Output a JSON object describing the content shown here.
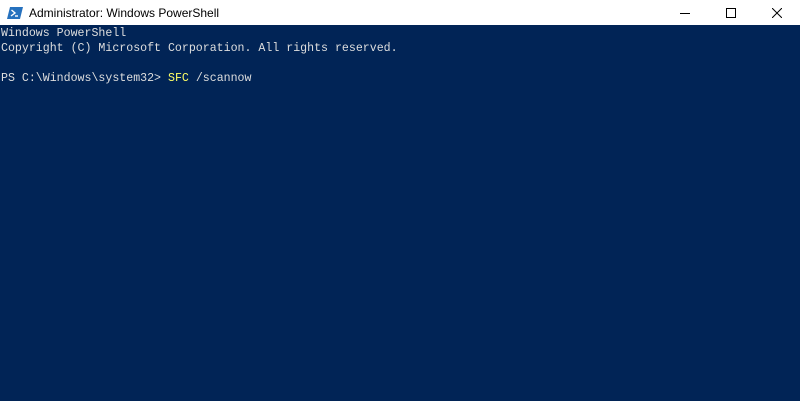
{
  "window": {
    "title": "Administrator: Windows PowerShell",
    "icon": "powershell-icon"
  },
  "controls": {
    "minimize_icon": "minimize-icon",
    "maximize_icon": "maximize-icon",
    "close_icon": "close-icon"
  },
  "console": {
    "banner_line1": "Windows PowerShell",
    "banner_line2": "Copyright (C) Microsoft Corporation. All rights reserved.",
    "prompt": "PS C:\\Windows\\system32> ",
    "command": "SFC",
    "argument": " /scannow"
  },
  "colors": {
    "background": "#012456",
    "text": "#dedede",
    "command": "#ffff66"
  }
}
